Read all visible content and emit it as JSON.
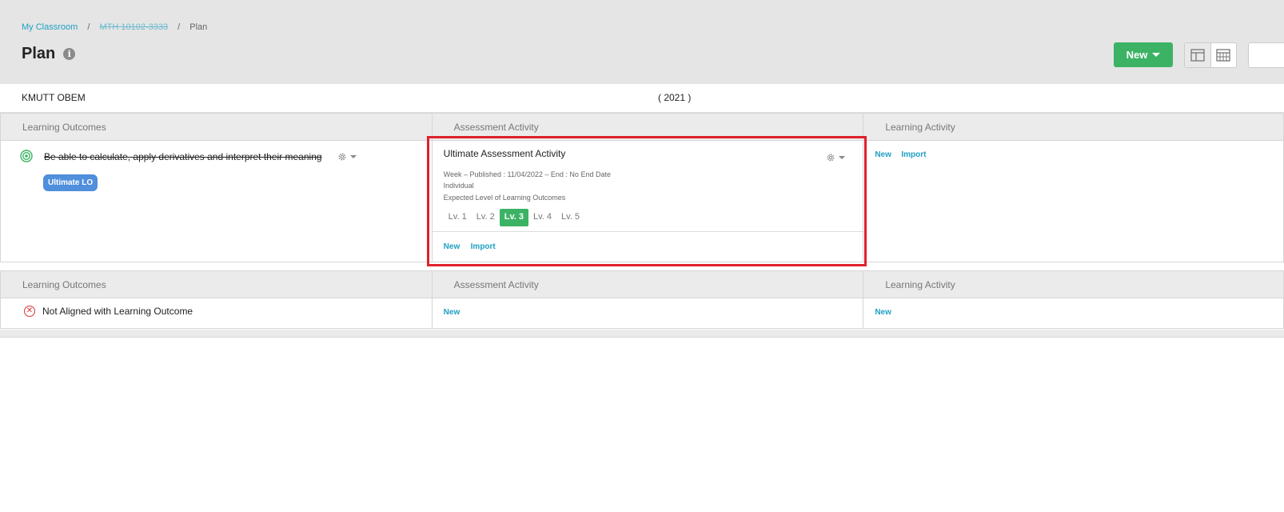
{
  "breadcrumb": {
    "home": "My Classroom",
    "course": "MTH 10102-3333",
    "current": "Plan"
  },
  "page": {
    "title": "Plan",
    "info_glyph": "i"
  },
  "toolbar": {
    "new_label": "New"
  },
  "plan": {
    "program": "KMUTT OBEM",
    "year": "( 2021 )"
  },
  "table1": {
    "headers": [
      "Learning Outcomes",
      "Assessment Activity",
      "Learning Activity"
    ],
    "lo": {
      "text": "Be able to calculate, apply derivatives and interpret their meaning",
      "badge": "Ultimate LO"
    },
    "assessment": {
      "title": "Ultimate Assessment Activity",
      "meta_line": "Week –   Published : 11/04/2022 – End : No End Date",
      "type": "Individual",
      "expected": "Expected Level of Learning Outcomes",
      "levels": [
        "Lv. 1",
        "Lv. 2",
        "Lv. 3",
        "Lv. 4",
        "Lv. 5"
      ],
      "selected_level": "Lv. 3",
      "new_label": "New",
      "import_label": "Import"
    },
    "learning_activity": {
      "new_label": "New",
      "import_label": "Import"
    }
  },
  "table2": {
    "headers": [
      "Learning Outcomes",
      "Assessment Activity",
      "Learning Activity"
    ],
    "lo_text": "Not Aligned with Learning Outcome",
    "assessment_new": "New",
    "activity_new": "New"
  },
  "colors": {
    "accent": "#3cb364",
    "link": "#1f9fc2",
    "badge": "#4f8fdc",
    "highlight": "#e0212b",
    "danger": "#d9383a"
  }
}
